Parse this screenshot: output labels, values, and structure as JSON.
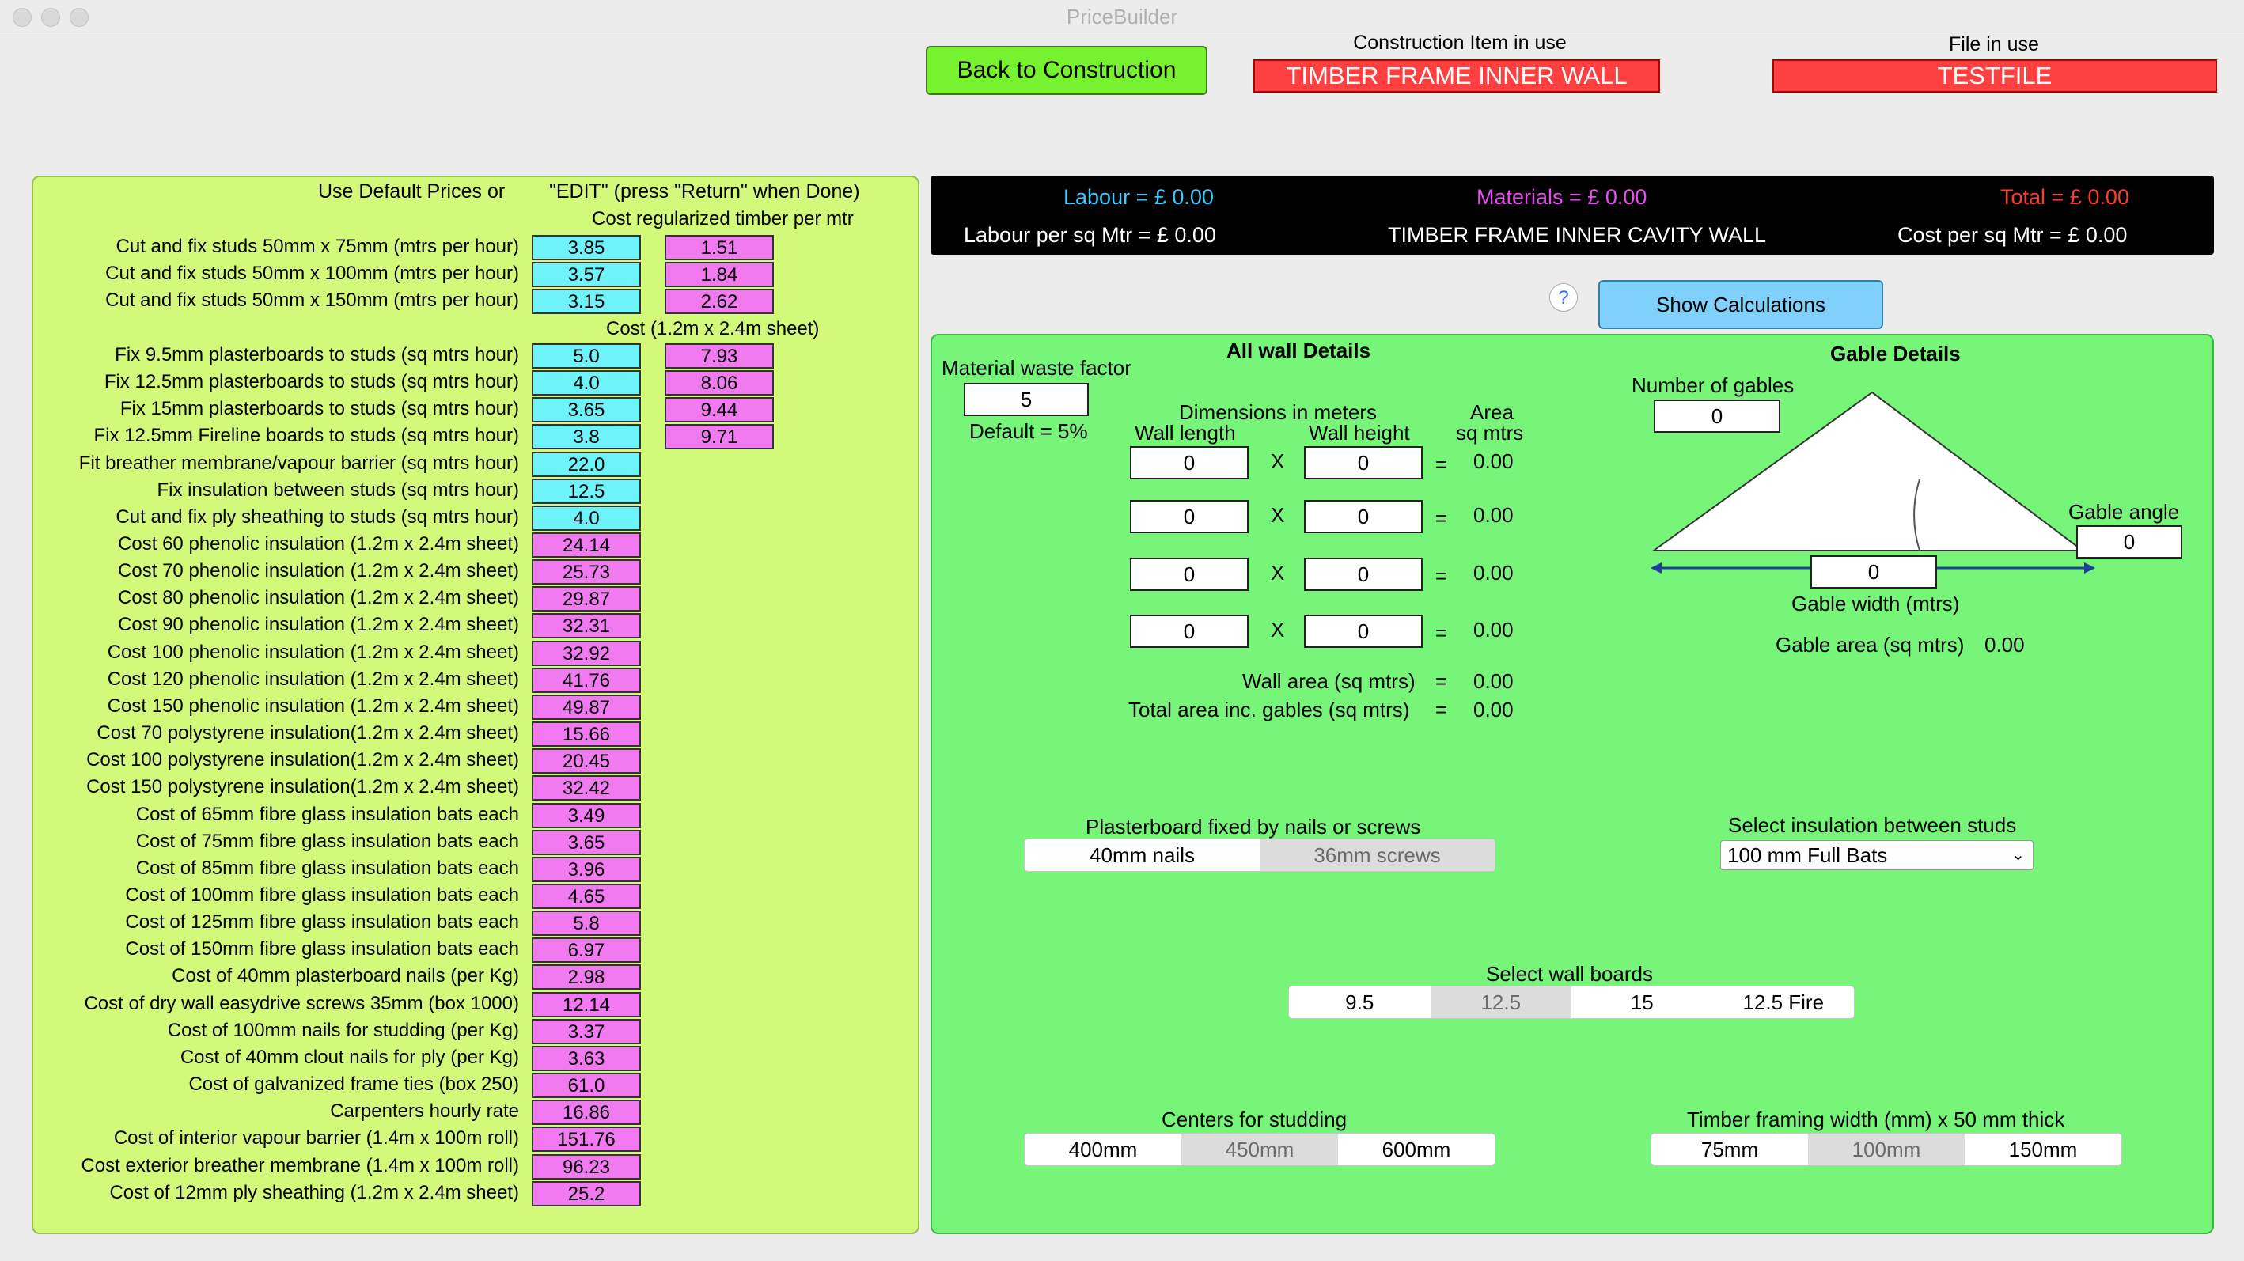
{
  "window": {
    "title": "PriceBuilder"
  },
  "header": {
    "back_button": "Back to Construction",
    "construction_label": "Construction Item in use",
    "construction_value": "TIMBER FRAME INNER WALL",
    "file_label": "File in use",
    "file_value": "TESTFILE"
  },
  "left": {
    "title_default": "Use Default Prices or",
    "title_edit": "\"EDIT\"   (press \"Return\" when Done)",
    "timber_header": "Cost regularized timber per mtr",
    "sheet_header": "Cost (1.2m x 2.4m sheet)",
    "rows": [
      {
        "label": "Cut and fix studs 50mm x 75mm (mtrs per hour)",
        "value": "3.85",
        "cost": "1.51",
        "color": "cyan"
      },
      {
        "label": "Cut and fix studs 50mm x 100mm (mtrs per hour)",
        "value": "3.57",
        "cost": "1.84",
        "color": "cyan"
      },
      {
        "label": "Cut and fix studs 50mm x 150mm (mtrs per hour)",
        "value": "3.15",
        "cost": "2.62",
        "color": "cyan"
      },
      {
        "label": "Fix 9.5mm plasterboards to studs (sq mtrs hour)",
        "value": "5.0",
        "cost": "7.93",
        "color": "cyan"
      },
      {
        "label": "Fix 12.5mm plasterboards to studs (sq mtrs hour)",
        "value": "4.0",
        "cost": "8.06",
        "color": "cyan"
      },
      {
        "label": "Fix 15mm plasterboards to studs (sq mtrs hour)",
        "value": "3.65",
        "cost": "9.44",
        "color": "cyan"
      },
      {
        "label": "Fix 12.5mm Fireline boards to studs (sq mtrs hour)",
        "value": "3.8",
        "cost": "9.71",
        "color": "cyan"
      },
      {
        "label": "Fit breather membrane/vapour barrier (sq mtrs hour)",
        "value": "22.0",
        "color": "cyan"
      },
      {
        "label": "Fix insulation between studs (sq mtrs hour)",
        "value": "12.5",
        "color": "cyan"
      },
      {
        "label": "Cut and fix ply sheathing to studs (sq mtrs hour)",
        "value": "4.0",
        "color": "cyan"
      },
      {
        "label": "Cost 60 phenolic insulation (1.2m x 2.4m sheet)",
        "value": "24.14",
        "color": "pink"
      },
      {
        "label": "Cost 70 phenolic insulation (1.2m x 2.4m sheet)",
        "value": "25.73",
        "color": "pink"
      },
      {
        "label": "Cost 80 phenolic insulation (1.2m x 2.4m sheet)",
        "value": "29.87",
        "color": "pink"
      },
      {
        "label": "Cost 90 phenolic insulation (1.2m x 2.4m sheet)",
        "value": "32.31",
        "color": "pink"
      },
      {
        "label": "Cost 100 phenolic insulation (1.2m x 2.4m sheet)",
        "value": "32.92",
        "color": "pink"
      },
      {
        "label": "Cost 120 phenolic insulation (1.2m x 2.4m sheet)",
        "value": "41.76",
        "color": "pink"
      },
      {
        "label": "Cost 150 phenolic insulation (1.2m x 2.4m sheet)",
        "value": "49.87",
        "color": "pink"
      },
      {
        "label": "Cost 70 polystyrene insulation(1.2m x 2.4m sheet)",
        "value": "15.66",
        "color": "pink"
      },
      {
        "label": "Cost 100 polystyrene insulation(1.2m x 2.4m sheet)",
        "value": "20.45",
        "color": "pink"
      },
      {
        "label": "Cost 150 polystyrene insulation(1.2m x 2.4m sheet)",
        "value": "32.42",
        "color": "pink"
      },
      {
        "label": "Cost of 65mm fibre glass insulation bats each",
        "value": "3.49",
        "color": "pink"
      },
      {
        "label": "Cost of 75mm fibre glass insulation bats each",
        "value": "3.65",
        "color": "pink"
      },
      {
        "label": "Cost of 85mm fibre glass insulation bats each",
        "value": "3.96",
        "color": "pink"
      },
      {
        "label": "Cost of 100mm fibre glass insulation bats each",
        "value": "4.65",
        "color": "pink"
      },
      {
        "label": "Cost of 125mm fibre glass insulation bats each",
        "value": "5.8",
        "color": "pink"
      },
      {
        "label": "Cost of 150mm fibre glass insulation bats each",
        "value": "6.97",
        "color": "pink"
      },
      {
        "label": "Cost of 40mm plasterboard nails (per Kg)",
        "value": "2.98",
        "color": "pink"
      },
      {
        "label": "Cost of dry wall easydrive screws 35mm (box 1000)",
        "value": "12.14",
        "color": "pink"
      },
      {
        "label": "Cost of 100mm nails for studding (per Kg)",
        "value": "3.37",
        "color": "pink"
      },
      {
        "label": "Cost of 40mm clout nails for ply (per Kg)",
        "value": "3.63",
        "color": "pink"
      },
      {
        "label": "Cost of galvanized frame ties (box 250)",
        "value": "61.0",
        "color": "pink"
      },
      {
        "label": "Carpenters hourly rate",
        "value": "16.86",
        "color": "pink"
      },
      {
        "label": "Cost of interior vapour barrier (1.4m x 100m roll)",
        "value": "151.76",
        "color": "pink"
      },
      {
        "label": "Cost exterior breather membrane (1.4m x 100m roll)",
        "value": "96.23",
        "color": "pink"
      },
      {
        "label": "Cost of 12mm ply sheathing (1.2m x 2.4m sheet)",
        "value": "25.2",
        "color": "pink"
      }
    ]
  },
  "summary": {
    "labour": "Labour = £  0.00",
    "materials": "Materials = £ 0.00",
    "total": "Total = £  0.00",
    "labour_per_sqm": "Labour per sq Mtr = £  0.00",
    "item_name": "TIMBER FRAME INNER CAVITY WALL",
    "cost_per_sqm": "Cost per sq Mtr = £  0.00",
    "colors": {
      "labour": "#3fc8ff",
      "materials": "#e84cf0",
      "total": "#ff3b2f"
    }
  },
  "help_button": "?",
  "show_calculations": "Show Calculations",
  "wall": {
    "heading": "All wall Details",
    "waste_label": "Material waste factor",
    "waste_value": "5",
    "waste_default": "Default = 5%",
    "dims_header": "Dimensions in meters",
    "length_header": "Wall length",
    "height_header": "Wall height",
    "area_header_1": "Area",
    "area_header_2": "sq mtrs",
    "times": "X",
    "equals": "=",
    "rows": [
      {
        "length": "0",
        "height": "0",
        "area": "0.00"
      },
      {
        "length": "0",
        "height": "0",
        "area": "0.00"
      },
      {
        "length": "0",
        "height": "0",
        "area": "0.00"
      },
      {
        "length": "0",
        "height": "0",
        "area": "0.00"
      }
    ],
    "wall_area_label": "Wall area (sq mtrs)",
    "wall_area_value": "0.00",
    "total_area_label": "Total area inc. gables (sq mtrs)",
    "total_area_value": "0.00"
  },
  "gable": {
    "heading": "Gable Details",
    "number_label": "Number of gables",
    "number_value": "0",
    "angle_label": "Gable angle",
    "angle_value": "0",
    "width_value": "0",
    "width_label": "Gable width (mtrs)",
    "area_label": "Gable area (sq mtrs)",
    "area_value": "0.00"
  },
  "plasterboard": {
    "label": "Plasterboard fixed by nails or screws",
    "options": [
      "40mm nails",
      "36mm screws"
    ],
    "selected": 1
  },
  "insulation": {
    "label": "Select insulation between studs",
    "value": "100 mm Full Bats"
  },
  "wall_boards": {
    "label": "Select wall boards",
    "options": [
      "9.5",
      "12.5",
      "15",
      "12.5 Fire"
    ],
    "selected": 1
  },
  "studding": {
    "label": "Centers for studding",
    "options": [
      "400mm",
      "450mm",
      "600mm"
    ],
    "selected": 1
  },
  "timber_width": {
    "label": "Timber framing width (mm) x 50 mm thick",
    "options": [
      "75mm",
      "100mm",
      "150mm"
    ],
    "selected": 1
  }
}
